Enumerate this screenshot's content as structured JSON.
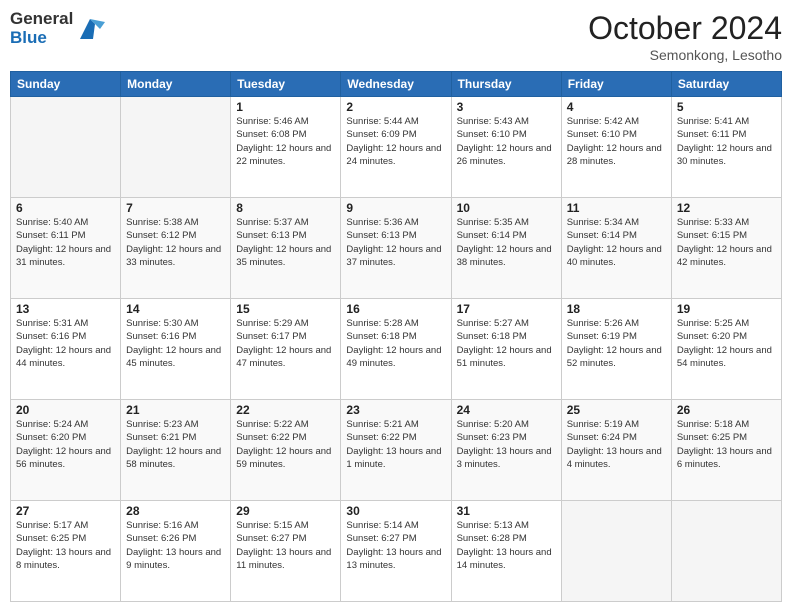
{
  "logo": {
    "general": "General",
    "blue": "Blue"
  },
  "header": {
    "month": "October 2024",
    "location": "Semonkong, Lesotho"
  },
  "weekdays": [
    "Sunday",
    "Monday",
    "Tuesday",
    "Wednesday",
    "Thursday",
    "Friday",
    "Saturday"
  ],
  "weeks": [
    [
      {
        "day": "",
        "info": ""
      },
      {
        "day": "",
        "info": ""
      },
      {
        "day": "1",
        "info": "Sunrise: 5:46 AM\nSunset: 6:08 PM\nDaylight: 12 hours and 22 minutes."
      },
      {
        "day": "2",
        "info": "Sunrise: 5:44 AM\nSunset: 6:09 PM\nDaylight: 12 hours and 24 minutes."
      },
      {
        "day": "3",
        "info": "Sunrise: 5:43 AM\nSunset: 6:10 PM\nDaylight: 12 hours and 26 minutes."
      },
      {
        "day": "4",
        "info": "Sunrise: 5:42 AM\nSunset: 6:10 PM\nDaylight: 12 hours and 28 minutes."
      },
      {
        "day": "5",
        "info": "Sunrise: 5:41 AM\nSunset: 6:11 PM\nDaylight: 12 hours and 30 minutes."
      }
    ],
    [
      {
        "day": "6",
        "info": "Sunrise: 5:40 AM\nSunset: 6:11 PM\nDaylight: 12 hours and 31 minutes."
      },
      {
        "day": "7",
        "info": "Sunrise: 5:38 AM\nSunset: 6:12 PM\nDaylight: 12 hours and 33 minutes."
      },
      {
        "day": "8",
        "info": "Sunrise: 5:37 AM\nSunset: 6:13 PM\nDaylight: 12 hours and 35 minutes."
      },
      {
        "day": "9",
        "info": "Sunrise: 5:36 AM\nSunset: 6:13 PM\nDaylight: 12 hours and 37 minutes."
      },
      {
        "day": "10",
        "info": "Sunrise: 5:35 AM\nSunset: 6:14 PM\nDaylight: 12 hours and 38 minutes."
      },
      {
        "day": "11",
        "info": "Sunrise: 5:34 AM\nSunset: 6:14 PM\nDaylight: 12 hours and 40 minutes."
      },
      {
        "day": "12",
        "info": "Sunrise: 5:33 AM\nSunset: 6:15 PM\nDaylight: 12 hours and 42 minutes."
      }
    ],
    [
      {
        "day": "13",
        "info": "Sunrise: 5:31 AM\nSunset: 6:16 PM\nDaylight: 12 hours and 44 minutes."
      },
      {
        "day": "14",
        "info": "Sunrise: 5:30 AM\nSunset: 6:16 PM\nDaylight: 12 hours and 45 minutes."
      },
      {
        "day": "15",
        "info": "Sunrise: 5:29 AM\nSunset: 6:17 PM\nDaylight: 12 hours and 47 minutes."
      },
      {
        "day": "16",
        "info": "Sunrise: 5:28 AM\nSunset: 6:18 PM\nDaylight: 12 hours and 49 minutes."
      },
      {
        "day": "17",
        "info": "Sunrise: 5:27 AM\nSunset: 6:18 PM\nDaylight: 12 hours and 51 minutes."
      },
      {
        "day": "18",
        "info": "Sunrise: 5:26 AM\nSunset: 6:19 PM\nDaylight: 12 hours and 52 minutes."
      },
      {
        "day": "19",
        "info": "Sunrise: 5:25 AM\nSunset: 6:20 PM\nDaylight: 12 hours and 54 minutes."
      }
    ],
    [
      {
        "day": "20",
        "info": "Sunrise: 5:24 AM\nSunset: 6:20 PM\nDaylight: 12 hours and 56 minutes."
      },
      {
        "day": "21",
        "info": "Sunrise: 5:23 AM\nSunset: 6:21 PM\nDaylight: 12 hours and 58 minutes."
      },
      {
        "day": "22",
        "info": "Sunrise: 5:22 AM\nSunset: 6:22 PM\nDaylight: 12 hours and 59 minutes."
      },
      {
        "day": "23",
        "info": "Sunrise: 5:21 AM\nSunset: 6:22 PM\nDaylight: 13 hours and 1 minute."
      },
      {
        "day": "24",
        "info": "Sunrise: 5:20 AM\nSunset: 6:23 PM\nDaylight: 13 hours and 3 minutes."
      },
      {
        "day": "25",
        "info": "Sunrise: 5:19 AM\nSunset: 6:24 PM\nDaylight: 13 hours and 4 minutes."
      },
      {
        "day": "26",
        "info": "Sunrise: 5:18 AM\nSunset: 6:25 PM\nDaylight: 13 hours and 6 minutes."
      }
    ],
    [
      {
        "day": "27",
        "info": "Sunrise: 5:17 AM\nSunset: 6:25 PM\nDaylight: 13 hours and 8 minutes."
      },
      {
        "day": "28",
        "info": "Sunrise: 5:16 AM\nSunset: 6:26 PM\nDaylight: 13 hours and 9 minutes."
      },
      {
        "day": "29",
        "info": "Sunrise: 5:15 AM\nSunset: 6:27 PM\nDaylight: 13 hours and 11 minutes."
      },
      {
        "day": "30",
        "info": "Sunrise: 5:14 AM\nSunset: 6:27 PM\nDaylight: 13 hours and 13 minutes."
      },
      {
        "day": "31",
        "info": "Sunrise: 5:13 AM\nSunset: 6:28 PM\nDaylight: 13 hours and 14 minutes."
      },
      {
        "day": "",
        "info": ""
      },
      {
        "day": "",
        "info": ""
      }
    ]
  ]
}
